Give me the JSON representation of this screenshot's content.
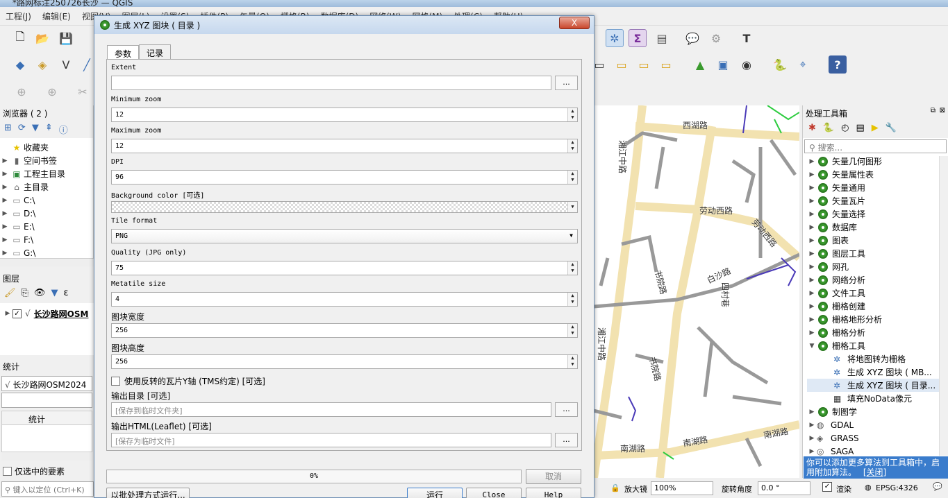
{
  "window": {
    "title": "*路网标注250726长沙 — QGIS"
  },
  "menu": [
    "工程(J)",
    "编辑(E)",
    "视图(V)",
    "图层(L)",
    "设置(S)",
    "插件(P)",
    "矢量(O)",
    "栅格(R)",
    "数据库(D)",
    "网络(W)",
    "网格(M)",
    "处理(C)",
    "帮助(H)"
  ],
  "browser": {
    "title": "浏览器 ( 2 )",
    "items": [
      "收藏夹",
      "空间书签",
      "工程主目录",
      "主目录",
      "C:\\",
      "D:\\",
      "E:\\",
      "F:\\",
      "G:\\"
    ]
  },
  "layers": {
    "title": "图层",
    "layer_name": "长沙路网OSM"
  },
  "stats": {
    "title": "统计",
    "layer": "长沙路网OSM2024",
    "column": "统计",
    "selected_only": "仅选中的要素"
  },
  "locator": {
    "placeholder": "键入以定位 (Ctrl+K)"
  },
  "dialog": {
    "title": "生成 XYZ 图块 ( 目录 )",
    "close": "X",
    "tabs": [
      "参数",
      "记录"
    ],
    "extent_label": "Extent",
    "extent_value": "",
    "min_zoom_label": "Minimum zoom",
    "min_zoom": "12",
    "max_zoom_label": "Maximum zoom",
    "max_zoom": "12",
    "dpi_label": "DPI",
    "dpi": "96",
    "bg_label": "Background color [可选]",
    "tile_format_label": "Tile format",
    "tile_format": "PNG",
    "quality_label": "Quality (JPG only)",
    "quality": "75",
    "metatile_label": "Metatile size",
    "metatile": "4",
    "width_label": "图块宽度",
    "width": "256",
    "height_label": "图块高度",
    "height": "256",
    "tms_label": "使用反转的瓦片Y轴 (TMS约定) [可选]",
    "outdir_label": "输出目录 [可选]",
    "outdir_placeholder": "[保存到临时文件夹]",
    "outhtml_label": "输出HTML(Leaflet) [可选]",
    "outhtml_placeholder": "[保存为临时文件]",
    "dots": "...",
    "progress": "0%",
    "cancel": "取消",
    "batch": "以批处理方式运行...",
    "run": "运行",
    "close_btn": "Close",
    "help": "Help"
  },
  "map": {
    "labels": [
      "西湖路",
      "湘江中路",
      "劳动西路",
      "劳动西路",
      "书院路",
      "白沙路",
      "四村巷",
      "湘江中路",
      "书院路",
      "湘江中路",
      "南湖路",
      "南湖路",
      "南湖路"
    ]
  },
  "toolbox": {
    "title": "处理工具箱",
    "search_placeholder": "搜索...",
    "groups": [
      "矢量几何图形",
      "矢量属性表",
      "矢量通用",
      "矢量瓦片",
      "矢量选择",
      "数据库",
      "图表",
      "图层工具",
      "网孔",
      "网络分析",
      "文件工具",
      "栅格创建",
      "栅格地形分析",
      "栅格分析",
      "栅格工具"
    ],
    "tools": [
      "将地图转为栅格",
      "生成 XYZ 图块 ( MB...",
      "生成 XYZ 图块 ( 目录...",
      "填充NoData像元"
    ],
    "providers": [
      "制图学",
      "GDAL",
      "GRASS",
      "SAGA"
    ],
    "notice": "你可以添加更多算法到工具箱中，启用附加算法。",
    "notice_close": "[关闭]"
  },
  "status": {
    "magnifier_label": "放大镜",
    "magnifier": "100%",
    "rotation_label": "旋转角度",
    "rotation": "0.0 °",
    "render": "渲染",
    "crs": "EPSG:4326"
  }
}
